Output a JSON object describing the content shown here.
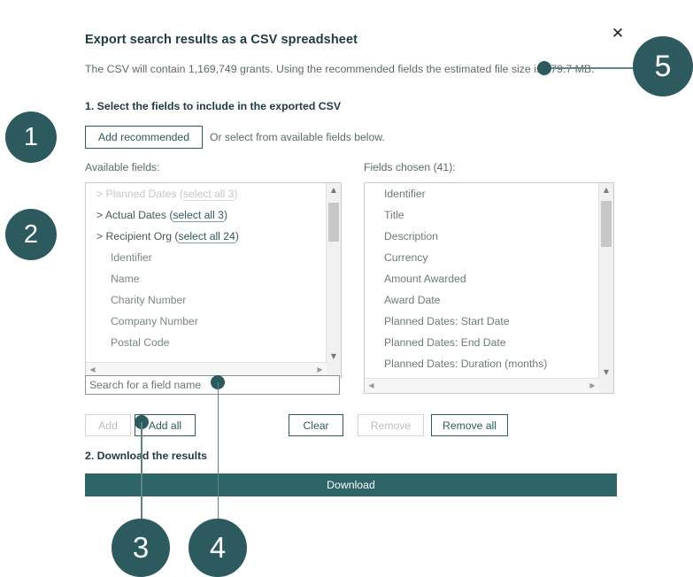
{
  "dialog": {
    "close_label": "✕",
    "title": "Export search results as a CSV spreadsheet",
    "subtitle": "The CSV will contain 1,169,749 grants. Using the recommended fields the estimated file size is 479.7 MB.",
    "step1_label": "1. Select the fields to include in the exported CSV",
    "step2_label": "2. Download the results",
    "add_recommended_label": "Add recommended",
    "or_select_text": "Or select from available fields below.",
    "download_label": "Download"
  },
  "available": {
    "label": "Available fields:",
    "items": [
      {
        "text": "> Planned Dates (",
        "link": "select all 3",
        "tail": ")",
        "group": true,
        "faded": true
      },
      {
        "text": "> Actual Dates (",
        "link": "select all 3",
        "tail": ")",
        "group": true,
        "faded": false
      },
      {
        "text": "> Recipient Org (",
        "link": "select all 24",
        "tail": ")",
        "group": true,
        "faded": false
      },
      {
        "text": "Identifier",
        "group": false,
        "faded": false
      },
      {
        "text": "Name",
        "group": false,
        "faded": false
      },
      {
        "text": "Charity Number",
        "group": false,
        "faded": false
      },
      {
        "text": "Company Number",
        "group": false,
        "faded": false
      },
      {
        "text": "Postal Code",
        "group": false,
        "faded": false
      }
    ],
    "search_placeholder": "Search for a field name",
    "search_value": ""
  },
  "chosen": {
    "label": "Fields chosen (41):",
    "count": 41,
    "items": [
      "Identifier",
      "Title",
      "Description",
      "Currency",
      "Amount Awarded",
      "Award Date",
      "Planned Dates: Start Date",
      "Planned Dates: End Date",
      "Planned Dates: Duration (months)"
    ]
  },
  "buttons": {
    "add": "Add",
    "add_all": "Add all",
    "clear": "Clear",
    "remove": "Remove",
    "remove_all": "Remove all"
  },
  "scroll_icons": {
    "up": "▲",
    "down": "▼",
    "left": "◀",
    "right": "▶"
  },
  "annotations": {
    "badges": [
      {
        "number": "1"
      },
      {
        "number": "2"
      },
      {
        "number": "3"
      },
      {
        "number": "4"
      },
      {
        "number": "5"
      }
    ]
  },
  "colors": {
    "accent": "#2d5a5e",
    "download_bg": "#2d6568",
    "badge_bg": "#2d5a5e",
    "muted_text": "#5d6a6b"
  }
}
